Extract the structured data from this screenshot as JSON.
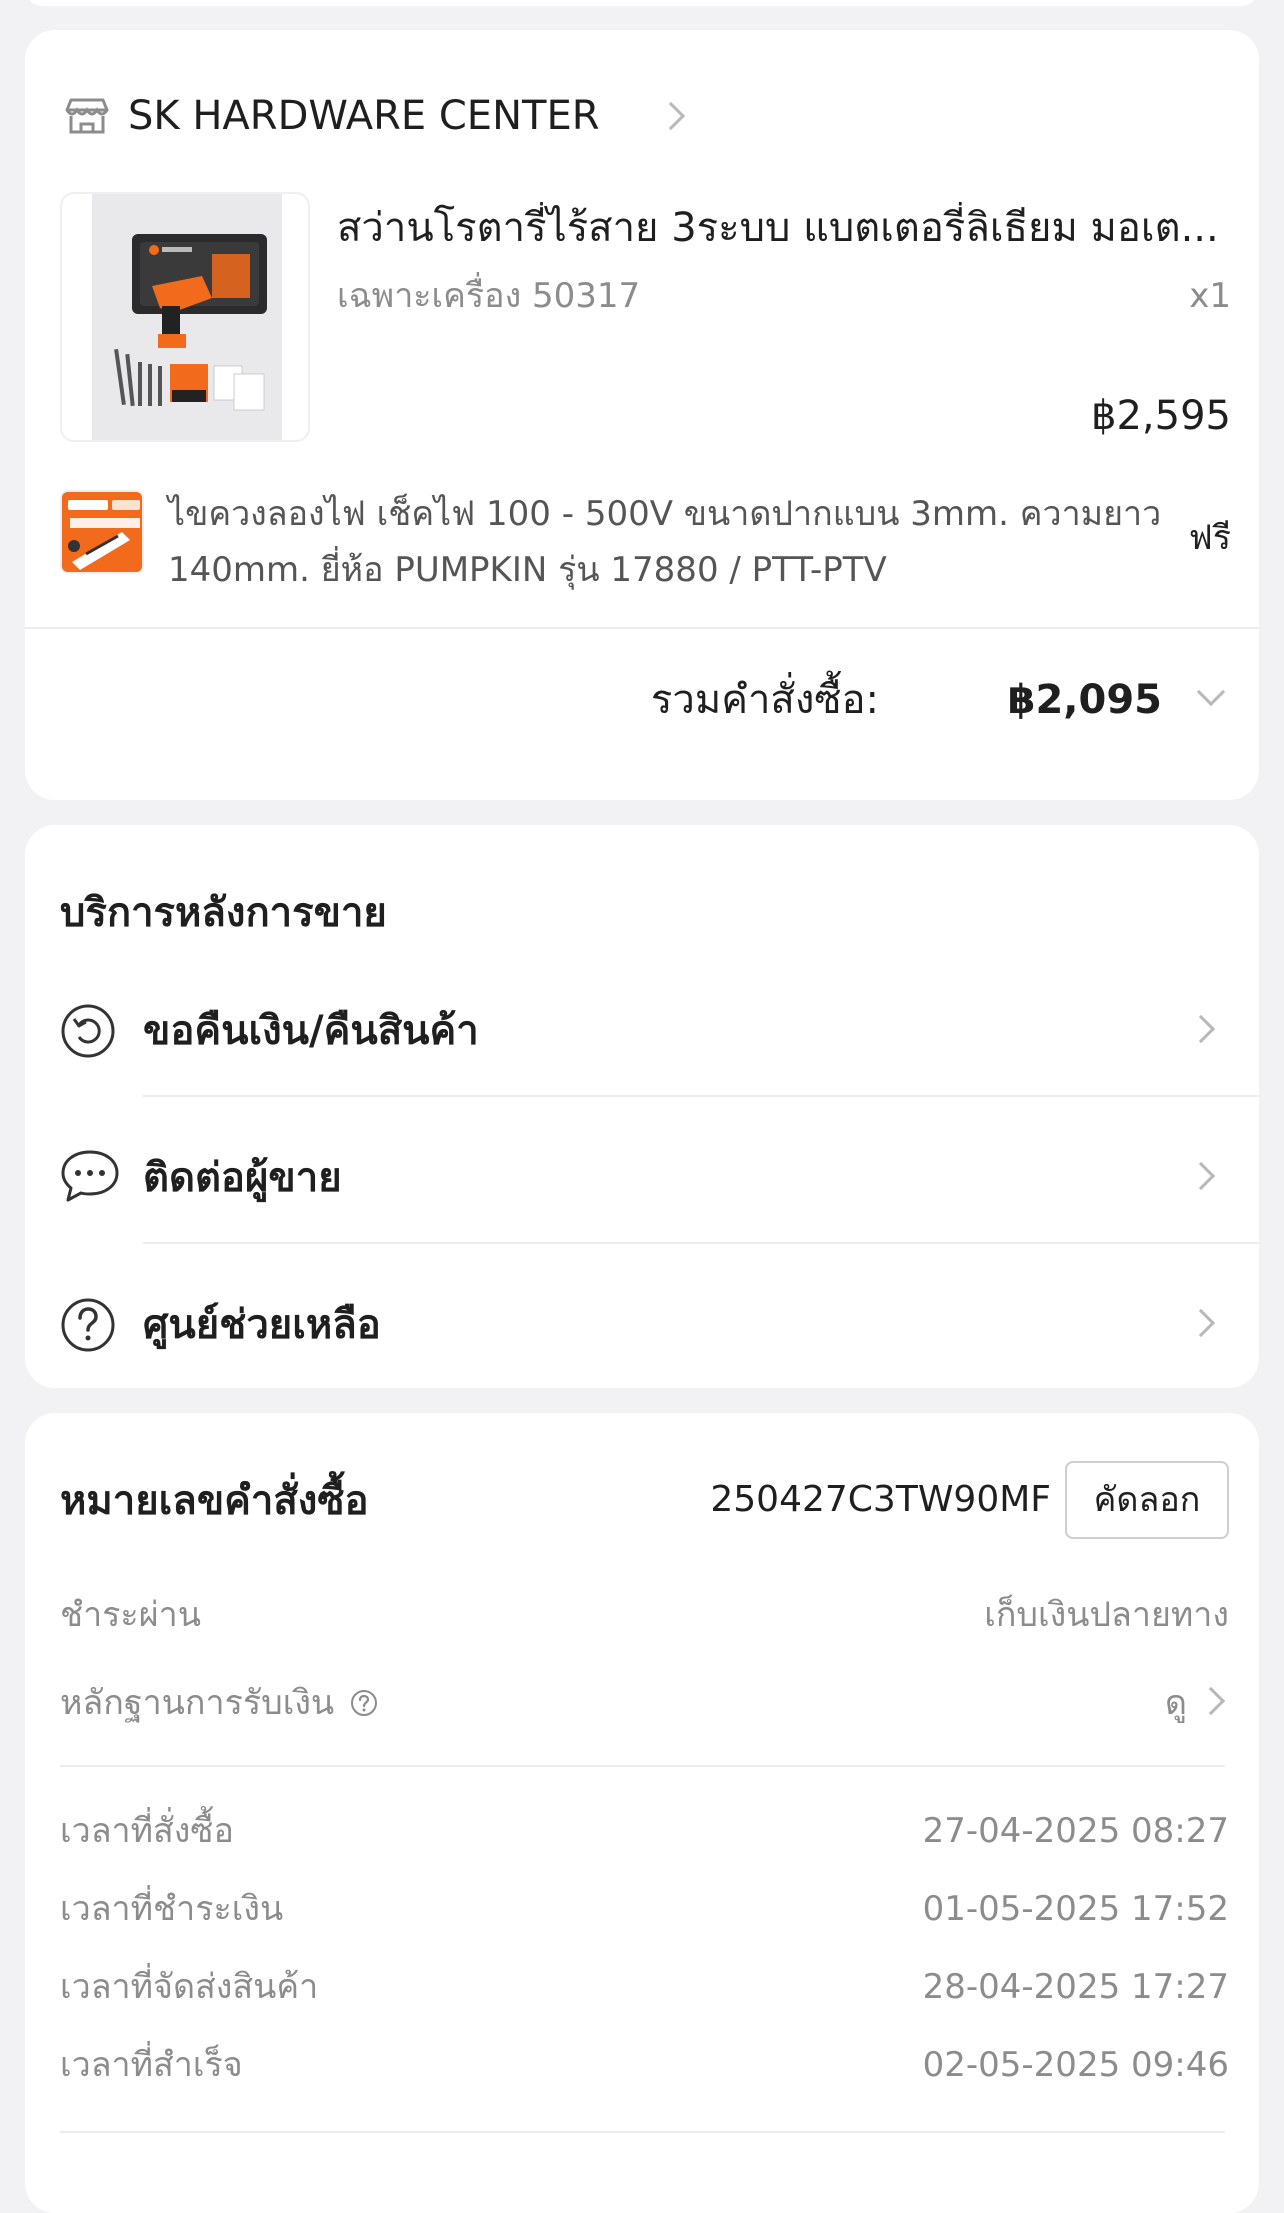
{
  "shop": {
    "name": "SK HARDWARE CENTER"
  },
  "product": {
    "title": "สว่านโรตารี่ไร้สาย 3ระบบ แบตเตอรี่ลิเธียม มอเต...",
    "variant": "เฉพาะเครื่อง 50317",
    "quantity": "x1",
    "price": "฿2,595"
  },
  "gift": {
    "title": "ไขควงลองไฟ เช็คไฟ 100 - 500V ขนาดปากแบน 3mm. ความยาว 140mm. ยี่ห้อ PUMPKIN รุ่น 17880 / PTT-PTV",
    "price_label": "ฟรี"
  },
  "order_total": {
    "label": "รวมคำสั่งซื้อ:",
    "value": "฿2,095"
  },
  "after_sales": {
    "title": "บริการหลังการขาย",
    "items": [
      {
        "label": "ขอคืนเงิน/คืนสินค้า",
        "icon": "return-icon"
      },
      {
        "label": "ติดต่อผู้ขาย",
        "icon": "chat-icon"
      },
      {
        "label": "ศูนย์ช่วยเหลือ",
        "icon": "help-icon"
      }
    ]
  },
  "order_info": {
    "order_no_label": "หมายเลขคำสั่งซื้อ",
    "order_no": "250427C3TW90MF",
    "copy_label": "คัดลอก",
    "payment_label": "ชำระผ่าน",
    "payment_value": "เก็บเงินปลายทาง",
    "proof_label": "หลักฐานการรับเงิน",
    "proof_action": "ดู",
    "times": [
      {
        "label": "เวลาที่สั่งซื้อ",
        "value": "27-04-2025 08:27"
      },
      {
        "label": "เวลาที่ชำระเงิน",
        "value": "01-05-2025 17:52"
      },
      {
        "label": "เวลาที่จัดส่งสินค้า",
        "value": "28-04-2025 17:27"
      },
      {
        "label": "เวลาที่สำเร็จ",
        "value": "02-05-2025 09:46"
      }
    ]
  },
  "colors": {
    "page_bg": "#f2f2f4",
    "card_bg": "#ffffff",
    "text_primary": "#1f1f1f",
    "text_secondary": "#8c8c8c",
    "product_orange": "#f26a1b"
  }
}
